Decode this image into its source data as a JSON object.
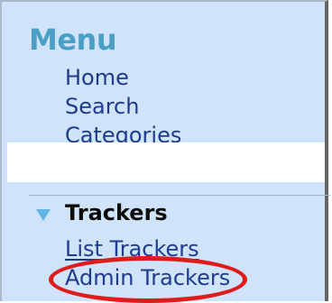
{
  "menu": {
    "title": "Menu",
    "items": [
      {
        "label": "Home"
      },
      {
        "label": "Search"
      },
      {
        "label": "Categories"
      }
    ]
  },
  "trackers": {
    "title": "Trackers",
    "items": [
      {
        "label": "List Trackers"
      },
      {
        "label": "Admin Trackers"
      }
    ]
  },
  "colors": {
    "panel_bg": "#cfe3fb",
    "title": "#4a9fc6",
    "link": "#1f3b8f",
    "highlight": "#e01b1b",
    "triangle": "#62b6e6"
  },
  "icons": {
    "section_toggle": "triangle-down-icon"
  }
}
